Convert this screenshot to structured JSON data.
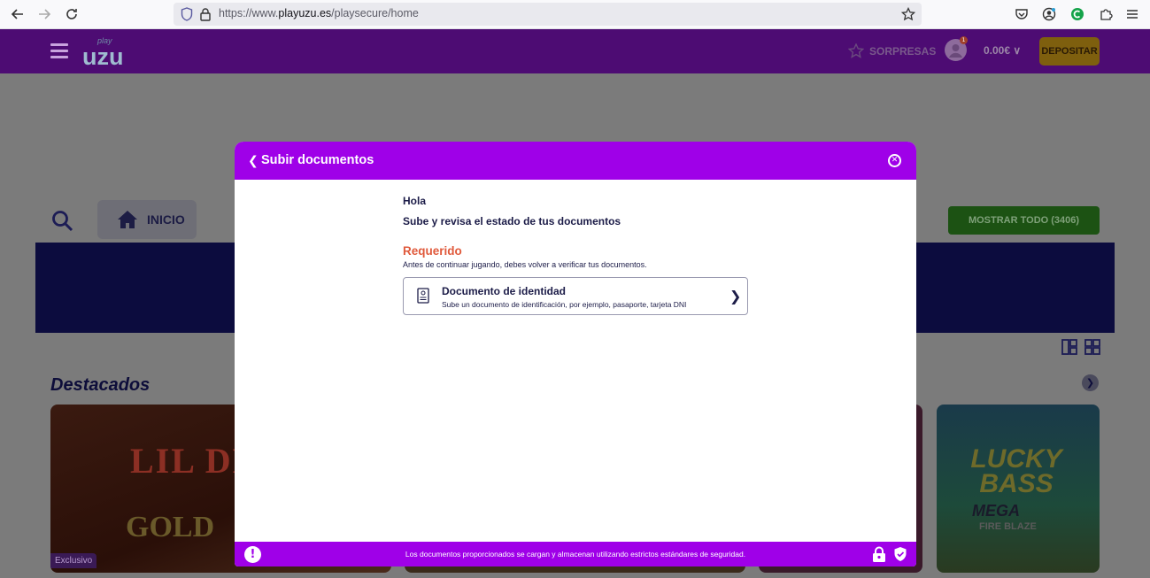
{
  "browser": {
    "url_prefix": "https://www.",
    "url_domain": "playuzu.es",
    "url_path": "/playsecure/home"
  },
  "header": {
    "logo_text": "uzu",
    "logo_small": "play",
    "sorpresas_label": "SORPRESAS",
    "notification_count": "1",
    "balance": "0.00€",
    "deposit_label": "DEPOSITAR"
  },
  "page": {
    "inicio_label": "INICIO",
    "show_all_label": "MOSTRAR TODO (3406)",
    "section_title": "Destacados",
    "games": [
      {
        "title": "LIL DEMO",
        "subtitle": "GOLD",
        "badge": "Exclusivo"
      },
      {
        "title": "",
        "subtitle": "",
        "badge": ""
      },
      {
        "title": "",
        "subtitle": "",
        "badge": ""
      },
      {
        "title": "LUCKY BASS",
        "subtitle": "MEGA",
        "subtitle2": "FIRE BLAZE",
        "badge": ""
      }
    ]
  },
  "modal": {
    "title": "Subir documentos",
    "greeting": "Hola",
    "subtitle": "Sube y revisa el estado de tus documentos",
    "required_label": "Requerido",
    "required_note": "Antes de continuar jugando, debes volver a verificar tus documentos.",
    "document": {
      "title": "Documento de identidad",
      "description": "Sube un documento de identificación, por ejemplo, pasaporte, tarjeta DNI"
    },
    "footer_text": "Los documentos proporcionados se cargan y almacenan utilizando estrictos estándares de seguridad.",
    "accent_color": "#9f00e8"
  }
}
